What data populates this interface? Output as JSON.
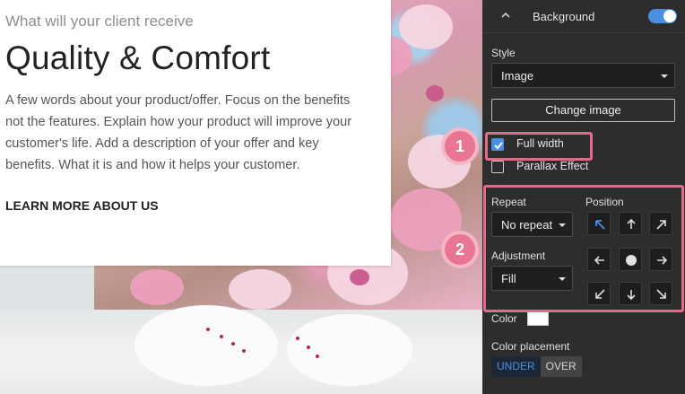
{
  "preview": {
    "eyebrow": "What will your client receive",
    "title": "Quality & Comfort",
    "body": "A few words about your product/offer. Focus on the benefits not the features. Explain how your product will improve your customer's life. Add a description of your offer and key benefits. What it is and how it helps your customer.",
    "cta": "LEARN MORE ABOUT US"
  },
  "panel": {
    "header": {
      "title": "Background",
      "toggle_on": true,
      "collapse_icon": "chevron-up-icon"
    },
    "style": {
      "label": "Style",
      "value": "Image"
    },
    "change_image_label": "Change image",
    "full_width": {
      "label": "Full width",
      "checked": true
    },
    "parallax": {
      "label": "Parallax Effect",
      "checked": false
    },
    "repeat": {
      "label": "Repeat",
      "value": "No repeat"
    },
    "adjustment": {
      "label": "Adjustment",
      "value": "Fill"
    },
    "position": {
      "label": "Position",
      "selected": "top-left",
      "icons": [
        "arrow-up-left-icon",
        "arrow-up-icon",
        "arrow-up-right-icon",
        "arrow-left-icon",
        "center-dot-icon",
        "arrow-right-icon",
        "arrow-down-left-icon",
        "arrow-down-icon",
        "arrow-down-right-icon"
      ]
    },
    "color": {
      "label": "Color",
      "value": "#ffffff"
    },
    "color_placement": {
      "label": "Color placement",
      "options": [
        "UNDER",
        "OVER"
      ],
      "selected": "UNDER"
    }
  },
  "annotations": {
    "badge1": "1",
    "badge2": "2",
    "color": "#e36a8b"
  },
  "colors": {
    "accent": "#4a90e2",
    "panel_bg": "#2d2d2d"
  }
}
